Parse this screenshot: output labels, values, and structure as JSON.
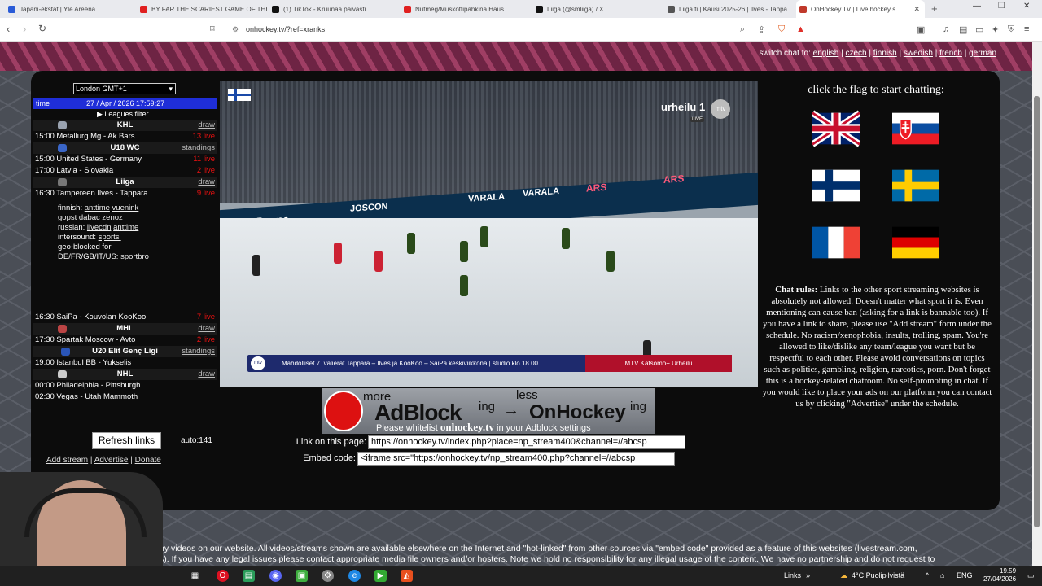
{
  "browser": {
    "tabs": [
      {
        "label": "Japani-ekstat | Yle Areena",
        "color": "#2a5bd7"
      },
      {
        "label": "BY FAR THE SCARIEST GAME OF THE",
        "color": "#e02020"
      },
      {
        "label": "(1) TikTok - Kruunaa päivästi",
        "color": "#111111"
      },
      {
        "label": "Nutmeg/Muskottipähkinä Haus",
        "color": "#e02020"
      },
      {
        "label": "Liiga (@smliiga) / X",
        "color": "#111111"
      },
      {
        "label": "Liiga.fi | Kausi 2025-26 | Ilves - Tappa",
        "color": "#555555"
      },
      {
        "label": "OnHockey.TV | Live hockey s",
        "color": "#c0392b"
      }
    ],
    "url": "onhockey.tv/?ref=xranks"
  },
  "banner": {
    "prefix": "switch chat to:",
    "langs": [
      "english",
      "czech",
      "finnish",
      "swedish",
      "french",
      "german"
    ]
  },
  "schedule": {
    "timezone": "London GMT+1",
    "time_label": "time",
    "time_value": "27 / Apr / 2026 17:59:27",
    "leagues_filter": "▶ Leagues filter",
    "rows": [
      {
        "kind": "league",
        "name": "KHL",
        "right": "draw"
      },
      {
        "kind": "game",
        "time": "15:00",
        "name": "Metallurg Mg - Ak Bars",
        "right": "13 live"
      },
      {
        "kind": "league",
        "name": "U18 WC",
        "right": "standings"
      },
      {
        "kind": "game",
        "time": "15:00",
        "name": "United States - Germany",
        "right": "11 live"
      },
      {
        "kind": "game",
        "time": "17:00",
        "name": "Latvia - Slovakia",
        "right": "2 live"
      },
      {
        "kind": "league",
        "name": "Liiga",
        "right": "draw"
      },
      {
        "kind": "game",
        "time": "16:30",
        "name": "Tampereen Ilves - Tappara",
        "right": "9 live"
      }
    ],
    "info": {
      "finnish_label": "finnish:",
      "finnish_links": [
        "anttime",
        "vuenink"
      ],
      "extra_links": [
        "gopst",
        "dabac",
        "zenoz"
      ],
      "russian_label": "russian:",
      "russian_links": [
        "livecdn",
        "anttime"
      ],
      "intersound_label": "intersound:",
      "intersound_link": "sportsl",
      "geo_line1": "geo-blocked for",
      "geo_line2": "DE/FR/GB/IT/US:",
      "geo_link": "sportbro"
    },
    "rows2": [
      {
        "kind": "game",
        "time": "16:30",
        "name": "SaiPa - Kouvolan KooKoo",
        "right": "7 live"
      },
      {
        "kind": "league",
        "name": "MHL",
        "right": "draw"
      },
      {
        "kind": "game",
        "time": "17:30",
        "name": "Spartak Moscow - Avto",
        "right": "2 live"
      },
      {
        "kind": "league",
        "name": "U20 Elit Genç Ligi",
        "right": "standings"
      },
      {
        "kind": "game",
        "time": "19:00",
        "name": "Istanbul BB - Yukselis",
        "right": ""
      },
      {
        "kind": "league",
        "name": "NHL",
        "right": "draw"
      },
      {
        "kind": "game",
        "time": "00:00",
        "name": "Philadelphia - Pittsburgh",
        "right": ""
      },
      {
        "kind": "game",
        "time": "02:30",
        "name": "Vegas - Utah Mammoth",
        "right": ""
      }
    ],
    "refresh": "Refresh links",
    "auto": "auto:141",
    "footer_links": [
      "Add stream",
      "Advertise",
      "Donate"
    ]
  },
  "video": {
    "channel": "urheilu 1",
    "mtv_badge": "mtv",
    "live_badge": "LIVE",
    "ticker_logo": "mtv",
    "ticker": "Mahdolliset 7. välierät Tappara – Ilves ja KooKoo – SaiPa keskiviikkona | studio klo 18.00",
    "ticker_right": "MTV Katsomo+ Urheilu",
    "boards": [
      "JOSCON",
      "VARALA",
      "VARALA",
      "ARS",
      "ARS",
      "Prevas"
    ]
  },
  "adblock": {
    "more": "more",
    "less": "less",
    "ing1": "ing",
    "ing2": "ing",
    "main1": "AdBlock",
    "arrow": "→",
    "main2": "OnHockey",
    "sub_pre": "Please whitelist",
    "sub_site": "onhockey.tv",
    "sub_post": "in your Adblock settings"
  },
  "links": {
    "page_label": "Link on this page:",
    "page_value": "https://onhockey.tv/index.php?place=np_stream400&channel=//abcsp",
    "embed_label": "Embed code:",
    "embed_value": "<iframe src=\"https://onhockey.tv/np_stream400.php?channel=//abcsp"
  },
  "chat": {
    "title": "click the flag to start chatting:",
    "rules_title": "Chat rules:",
    "rules": "Links to the other sport streaming websites is absolutely not allowed. Doesn't matter what sport it is. Even mentioning can cause ban (asking for a link is bannable too). If you have a link to share, please use \"Add stream\" form under the schedule. No racism/xenophobia, insults, trolling, spam. You're allowed to like/dislike any team/league you want but be respectful to each other. Please avoid conversations on topics such as politics, gambling, religion, narcotics, porn. Don't forget this is a hockey-related chatroom. No self-promoting in chat. If you would like to place your ads on our platform you can contact us by clicking \"Advertise\" under the schedule."
  },
  "bottom": {
    "line1": "ny videos on our website. All videos/streams shown are available elsewhere on the Internet and \"hot-linked\" from other sources via \"embed code\" provided as a feature of this websites (livestream.com,",
    "line2": "s). If you have any legal issues please contact appropriate media file owners and/or hosters. Note we hold no responsibility for any illegal usage of the content. We have no partnership and do not request to"
  },
  "taskbar": {
    "links": "Links",
    "weather": "4°C Puolipilvistä",
    "lang": "ENG",
    "time": "19.59",
    "date": "27/04/2026"
  }
}
